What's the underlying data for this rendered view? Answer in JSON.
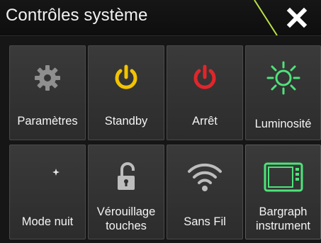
{
  "header": {
    "title": "Contrôles système",
    "close_icon": "close-icon"
  },
  "accent": {
    "header_slash": "#b8e04a",
    "standby_icon": "#f2c400",
    "power_icon": "#e0262b",
    "brightness_icon": "#4ee37a",
    "bargraph_icon": "#4ee37a"
  },
  "tiles": [
    {
      "label": "Paramètres",
      "icon": "gear-icon"
    },
    {
      "label": "Standby",
      "icon": "standby-icon"
    },
    {
      "label": "Arrêt",
      "icon": "power-icon"
    },
    {
      "label": "Luminosité",
      "icon": "brightness-icon"
    },
    {
      "label": "Mode nuit",
      "icon": "moon-icon"
    },
    {
      "label": "Vérouillage touches",
      "label_line1": "Vérouillage",
      "label_line2": "touches",
      "icon": "unlock-icon"
    },
    {
      "label": "Sans Fil",
      "icon": "wifi-icon"
    },
    {
      "label": "Bargraph instrument",
      "label_line1": "Bargraph",
      "label_line2": "instrument",
      "icon": "bargraph-instrument-icon"
    }
  ]
}
